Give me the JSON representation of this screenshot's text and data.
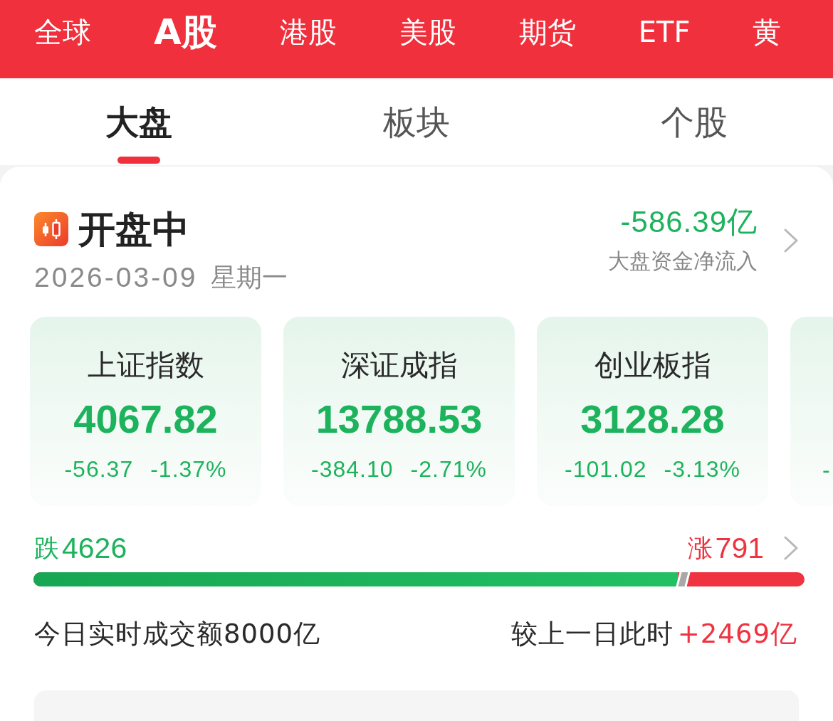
{
  "market_tabs": [
    {
      "label": "全球",
      "selected": false
    },
    {
      "label": "A股",
      "selected": true
    },
    {
      "label": "港股",
      "selected": false
    },
    {
      "label": "美股",
      "selected": false
    },
    {
      "label": "期货",
      "selected": false
    },
    {
      "label": "ETF",
      "selected": false
    },
    {
      "label": "黄",
      "selected": false
    }
  ],
  "sub_tabs": [
    {
      "label": "大盘",
      "selected": true
    },
    {
      "label": "板块",
      "selected": false
    },
    {
      "label": "个股",
      "selected": false
    }
  ],
  "session": {
    "status": "开盘中",
    "date": "2026-03-09",
    "weekday": "星期一",
    "net_flow": "-586.39亿",
    "net_flow_label": "大盘资金净流入"
  },
  "indices": [
    {
      "kind": "full",
      "name": "上证指数",
      "value": "4067.82",
      "change": "-56.37",
      "change_pct": "-1.37%"
    },
    {
      "kind": "full",
      "name": "深证成指",
      "value": "13788.53",
      "change": "-384.10",
      "change_pct": "-2.71%"
    },
    {
      "kind": "full",
      "name": "创业板指",
      "value": "3128.28",
      "change": "-101.02",
      "change_pct": "-3.13%"
    },
    {
      "kind": "partial",
      "change": "-"
    }
  ],
  "breadth": {
    "fall_label": "跌",
    "fall_count": "4626",
    "rise_label": "涨",
    "rise_count": "791",
    "level": 0.836
  },
  "turnover": {
    "text": "今日实时成交额8000亿",
    "compare_label": "较上一日此时",
    "compare_value": "+2469亿"
  }
}
